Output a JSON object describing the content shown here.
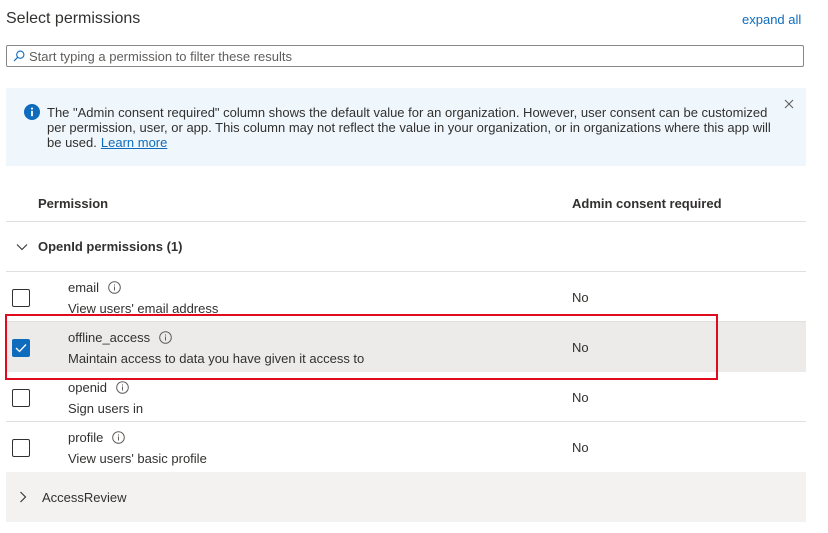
{
  "header": {
    "title": "Select permissions",
    "expand_all": "expand all"
  },
  "search": {
    "placeholder": "Start typing a permission to filter these results",
    "value": ""
  },
  "banner": {
    "text": "The \"Admin consent required\" column shows the default value for an organization. However, user consent can be customized per permission, user, or app. This column may not reflect the value in your organization, or in organizations where this app will be used.",
    "link": "Learn more"
  },
  "table": {
    "col_permission": "Permission",
    "col_admin": "Admin consent required",
    "group": {
      "label": "OpenId permissions (1)",
      "expanded": true
    },
    "rows": [
      {
        "name": "email",
        "description": "View users' email address",
        "admin": "No",
        "checked": false
      },
      {
        "name": "offline_access",
        "description": "Maintain access to data you have given it access to",
        "admin": "No",
        "checked": true
      },
      {
        "name": "openid",
        "description": "Sign users in",
        "admin": "No",
        "checked": false
      },
      {
        "name": "profile",
        "description": "View users' basic profile",
        "admin": "No",
        "checked": false
      }
    ],
    "collapsed_group": {
      "label": "AccessReview",
      "expanded": false
    }
  },
  "colors": {
    "accent": "#0f6cbd",
    "banner_bg": "#eff6fc",
    "selected_row_bg": "#edebe9",
    "highlight_border": "#e00b1c"
  }
}
